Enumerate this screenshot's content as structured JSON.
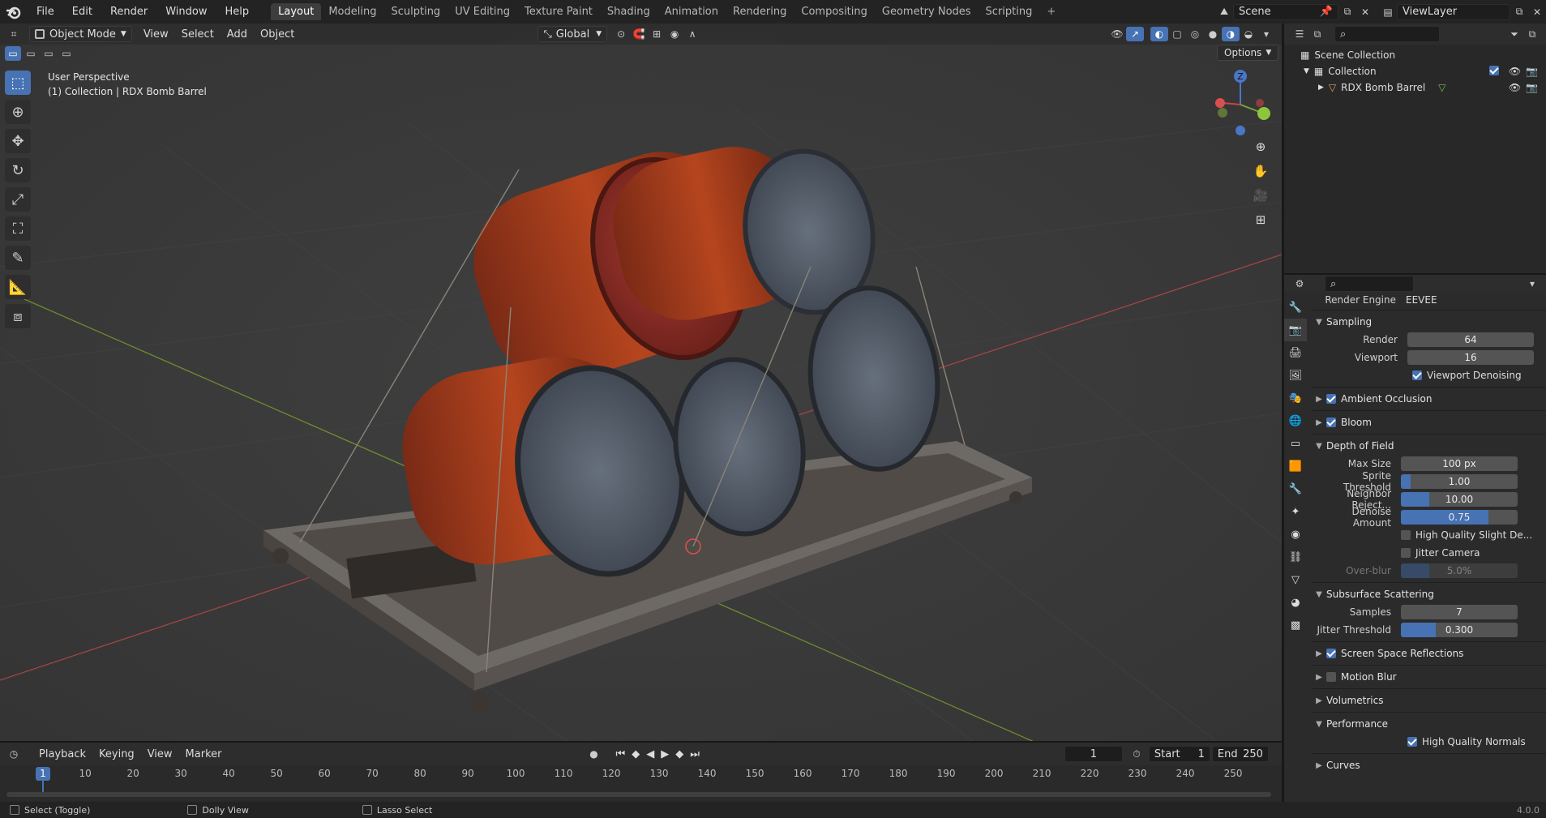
{
  "topbar": {
    "menus": [
      "File",
      "Edit",
      "Render",
      "Window",
      "Help"
    ],
    "workspaces": [
      "Layout",
      "Modeling",
      "Sculpting",
      "UV Editing",
      "Texture Paint",
      "Shading",
      "Animation",
      "Rendering",
      "Compositing",
      "Geometry Nodes",
      "Scripting"
    ],
    "active_workspace": "Layout",
    "add_tab": "+",
    "scene": "Scene",
    "view_layer": "ViewLayer"
  },
  "viewport": {
    "mode": "Object Mode",
    "menus": [
      "View",
      "Select",
      "Add",
      "Object"
    ],
    "transform_orientation": "Global",
    "options_label": "Options",
    "perspective_label": "User Perspective",
    "collection_label": "(1) Collection | RDX Bomb Barrel",
    "gizmo_axes": [
      "Z",
      "Y",
      "X"
    ]
  },
  "outliner": {
    "rows": [
      {
        "label": "Scene Collection"
      },
      {
        "label": "Collection"
      },
      {
        "label": "RDX Bomb Barrel"
      }
    ]
  },
  "properties": {
    "engine_label": "Render Engine",
    "engine_value": "EEVEE",
    "sections": {
      "sampling": "Sampling",
      "render_label": "Render",
      "render_value": "64",
      "viewport_label": "Viewport",
      "viewport_value": "16",
      "viewport_denoising": "Viewport Denoising",
      "ambient_occlusion": "Ambient Occlusion",
      "bloom": "Bloom",
      "dof": "Depth of Field",
      "max_size_label": "Max Size",
      "max_size_value": "100 px",
      "sprite_label": "Sprite Threshold",
      "sprite_value": "1.00",
      "neighbor_label": "Neighbor Reject...",
      "neighbor_value": "10.00",
      "denoise_label": "Denoise Amount",
      "denoise_value": "0.75",
      "hq_slight": "High Quality Slight De...",
      "jitter_camera": "Jitter Camera",
      "overblur_label": "Over-blur",
      "overblur_value": "5.0%",
      "sss": "Subsurface Scattering",
      "samples_label": "Samples",
      "samples_value": "7",
      "jitter_threshold_label": "Jitter Threshold",
      "jitter_threshold_value": "0.300",
      "ssr": "Screen Space Reflections",
      "motion_blur": "Motion Blur",
      "volumetrics": "Volumetrics",
      "performance": "Performance",
      "hq_normals": "High Quality Normals",
      "curves": "Curves"
    },
    "fills": {
      "sprite": 0.08,
      "neighbor": 0.24,
      "denoise": 0.75,
      "overblur": 0.24,
      "jitter": 0.3
    }
  },
  "timeline": {
    "menus": [
      "Playback",
      "Keying",
      "View",
      "Marker"
    ],
    "current_frame": "1",
    "start_label": "Start",
    "start_value": "1",
    "end_label": "End",
    "end_value": "250",
    "ticks": [
      "10",
      "20",
      "30",
      "40",
      "50",
      "60",
      "70",
      "80",
      "90",
      "100",
      "110",
      "120",
      "130",
      "140",
      "150",
      "160",
      "170",
      "180",
      "190",
      "200",
      "210",
      "220",
      "230",
      "240",
      "250"
    ],
    "playhead": "1"
  },
  "statusbar": {
    "select": "Select (Toggle)",
    "dolly": "Dolly View",
    "lasso": "Lasso Select",
    "version": "4.0.0"
  }
}
